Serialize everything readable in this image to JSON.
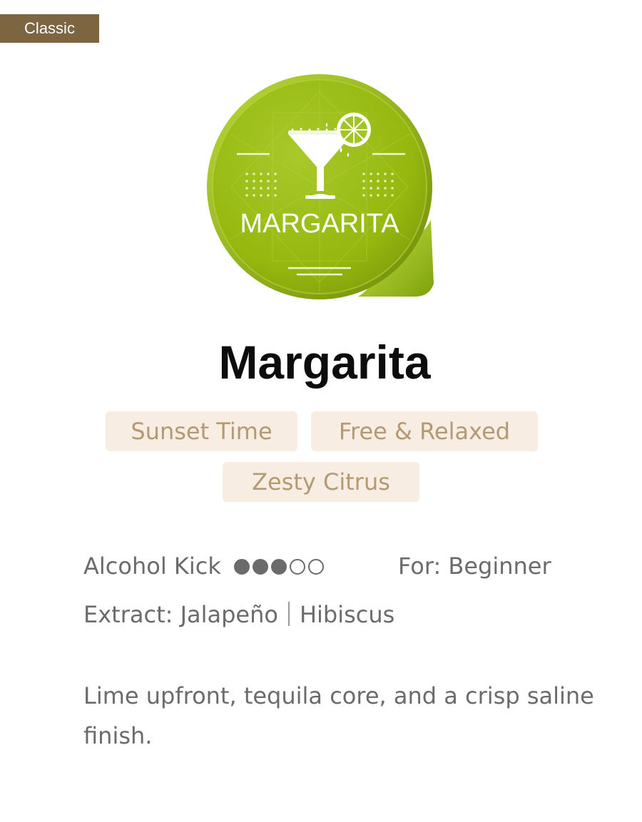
{
  "badge": "Classic",
  "capsule": {
    "label": "MARGARITA",
    "color": "#9bbd14",
    "icon": "martini-glass-with-lime-icon"
  },
  "drink": {
    "name": "Margarita",
    "tags": [
      "Sunset Time",
      "Free & Relaxed",
      "Zesty Citrus"
    ],
    "alcohol_kick_label": "Alcohol Kick",
    "alcohol_kick_level": 3,
    "alcohol_kick_max": 5,
    "for_label": "For: Beginner",
    "extract_label": "Extract: Jalapeño",
    "extract_second": "Hibiscus",
    "description": "Lime upfront, tequila core, and a crisp saline finish."
  },
  "colors": {
    "badge_bg": "#7d6541",
    "tag_bg": "#f7ede3",
    "tag_text": "#b49a72",
    "meta_text": "#6b6b6b"
  }
}
